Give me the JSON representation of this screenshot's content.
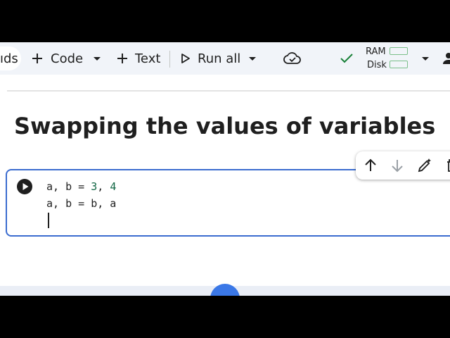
{
  "toolbar": {
    "partial_label": "ıds",
    "code_label": "Code",
    "text_label": "Text",
    "run_all_label": "Run all",
    "ram_label": "RAM",
    "disk_label": "Disk"
  },
  "notebook": {
    "section_heading": "Swapping the values of variables",
    "cell": {
      "line1": {
        "code": "a, b = ",
        "n1": "3",
        "sep": ", ",
        "n2": "4"
      },
      "line2": "a, b = b, a"
    }
  },
  "colors": {
    "accent": "#3b6ccf",
    "number": "#116644",
    "toolbar_bg": "#f1f4f9",
    "connected": "#188038"
  },
  "icons": [
    "plus-icon",
    "chevron-down-icon",
    "play-outline-icon",
    "cloud-check-icon",
    "checkmark-icon",
    "avatar-icon",
    "run-cell-icon",
    "arrow-up-icon",
    "arrow-down-icon",
    "edit-pencil-icon",
    "delete-icon"
  ]
}
